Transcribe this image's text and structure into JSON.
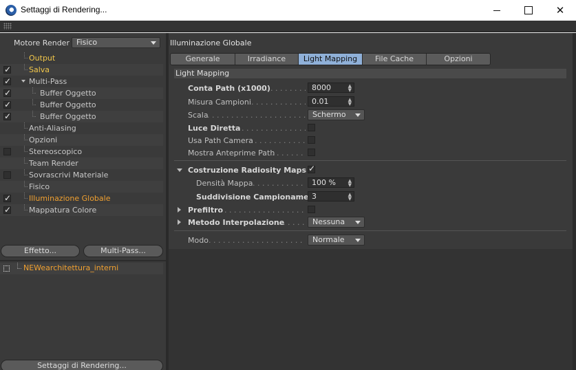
{
  "window": {
    "title": "Settaggi di Rendering..."
  },
  "left": {
    "engine_label": "Motore Render",
    "engine_value": "Fisico",
    "tree": [
      {
        "label": "Output",
        "check": "none",
        "indent": 1,
        "style": "yellow"
      },
      {
        "label": "Salva",
        "check": "on",
        "indent": 1,
        "style": "yellow"
      },
      {
        "label": "Multi-Pass",
        "check": "on",
        "indent": 1,
        "style": "normal",
        "expander": true
      },
      {
        "label": "Buffer Oggetto",
        "check": "on",
        "indent": 2,
        "style": "normal"
      },
      {
        "label": "Buffer Oggetto",
        "check": "on",
        "indent": 2,
        "style": "normal"
      },
      {
        "label": "Buffer Oggetto",
        "check": "on",
        "indent": 2,
        "style": "normal"
      },
      {
        "label": "Anti-Aliasing",
        "check": "none",
        "indent": 1,
        "style": "normal"
      },
      {
        "label": "Opzioni",
        "check": "none",
        "indent": 1,
        "style": "normal"
      },
      {
        "label": "Stereoscopico",
        "check": "off",
        "indent": 1,
        "style": "normal"
      },
      {
        "label": "Team Render",
        "check": "none",
        "indent": 1,
        "style": "normal"
      },
      {
        "label": "Sovrascrivi Materiale",
        "check": "off",
        "indent": 1,
        "style": "normal"
      },
      {
        "label": "Fisico",
        "check": "none",
        "indent": 1,
        "style": "normal"
      },
      {
        "label": "Illuminazione Globale",
        "check": "on",
        "indent": 1,
        "style": "active"
      },
      {
        "label": "Mappatura Colore",
        "check": "on",
        "indent": 1,
        "style": "normal"
      }
    ],
    "effect_button": "Effetto...",
    "multipass_button": "Multi-Pass...",
    "preset_label": "NEWearchitettura_interni",
    "settings_button": "Settaggi di Rendering..."
  },
  "right": {
    "section_title": "Illuminazione Globale",
    "tabs": [
      {
        "label": "Generale",
        "active": false
      },
      {
        "label": "Irradiance Cache",
        "active": false
      },
      {
        "label": "Light Mapping",
        "active": true
      },
      {
        "label": "File Cache",
        "active": false
      },
      {
        "label": "Opzioni",
        "active": false
      }
    ],
    "group_title": "Light Mapping",
    "params": {
      "conta_path": {
        "label": "Conta Path (x1000)",
        "value": "8000"
      },
      "misura_campioni": {
        "label": "Misura Campioni",
        "value": "0.01"
      },
      "scala": {
        "label": "Scala",
        "value": "Schermo"
      },
      "luce_diretta": {
        "label": "Luce Diretta",
        "checked": false
      },
      "usa_path_camera": {
        "label": "Usa Path Camera",
        "checked": false
      },
      "mostra_anteprime": {
        "label": "Mostra Anteprime Path",
        "checked": false
      },
      "costruzione_radiosity": {
        "label": "Costruzione Radiosity Maps",
        "checked": true
      },
      "densita_mappa": {
        "label": "Densità Mappa",
        "value": "100 %"
      },
      "suddivisione": {
        "label": "Suddivisione Campionamento",
        "value": "3"
      },
      "prefiltro": {
        "label": "Prefiltro",
        "checked": false
      },
      "metodo_interpolazione": {
        "label": "Metodo Interpolazione",
        "value": "Nessuna"
      },
      "modo": {
        "label": "Modo",
        "value": "Normale"
      }
    }
  }
}
